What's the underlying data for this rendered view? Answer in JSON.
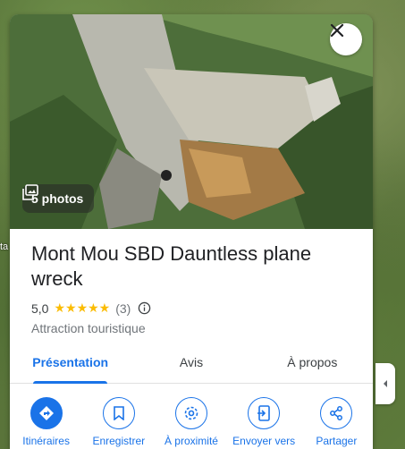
{
  "map": {
    "edge_label": "ta"
  },
  "hero": {
    "photos_label": "5 photos"
  },
  "place": {
    "title": "Mont Mou SBD Dauntless plane wreck",
    "rating": "5,0",
    "stars": "★★★★★",
    "review_count": "(3)",
    "category": "Attraction touristique"
  },
  "tabs": [
    {
      "label": "Présentation",
      "active": true
    },
    {
      "label": "Avis",
      "active": false
    },
    {
      "label": "À propos",
      "active": false
    }
  ],
  "actions": [
    {
      "label": "Itinéraires",
      "icon": "directions-icon"
    },
    {
      "label": "Enregistrer",
      "icon": "bookmark-icon"
    },
    {
      "label": "À proximité",
      "icon": "nearby-icon"
    },
    {
      "label": "Envoyer vers",
      "icon": "send-to-phone-icon"
    },
    {
      "label": "Partager",
      "icon": "share-icon"
    }
  ],
  "colors": {
    "accent": "#1a73e8",
    "star": "#fbbc04"
  }
}
